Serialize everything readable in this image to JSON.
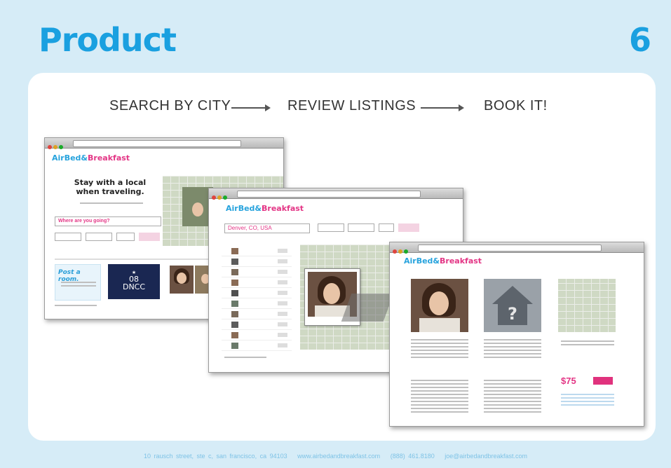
{
  "slide": {
    "title": "Product",
    "number": "6"
  },
  "steps": {
    "step1": "SEARCH BY CITY",
    "step2": "REVIEW LISTINGS",
    "step3": "BOOK IT!"
  },
  "screenshots": {
    "brand_part1": "AirBed&",
    "brand_part2": "Breakfast",
    "home": {
      "tagline_line1": "Stay with a local",
      "tagline_line2": "when traveling.",
      "search_prompt": "Where are you going?",
      "post_room": "Post a room.",
      "dnc_year": "08",
      "dnc_label": "DNCC"
    },
    "search": {
      "city_value": "Denver, CO, USA"
    },
    "listing": {
      "price": "$75"
    }
  },
  "footer": {
    "address": "10 rausch street, ste c, san francisco, ca 94103",
    "website": "www.airbedandbreakfast.com",
    "phone": "(888) 461.8180",
    "email": "joe@airbedandbreakfast.com"
  },
  "colors": {
    "accent_blue": "#1aa0e0",
    "brand_pink": "#e33585",
    "background": "#d6ecf7"
  }
}
